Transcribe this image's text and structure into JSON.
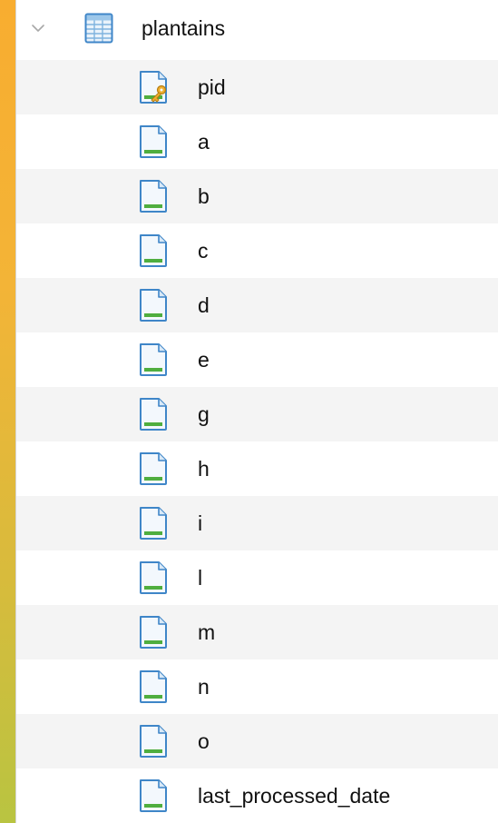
{
  "table": {
    "name": "plantains",
    "expanded": true
  },
  "columns": [
    {
      "label": "pid",
      "icon": "primary-key-column-icon"
    },
    {
      "label": "a",
      "icon": "column-icon"
    },
    {
      "label": "b",
      "icon": "column-icon"
    },
    {
      "label": "c",
      "icon": "column-icon"
    },
    {
      "label": "d",
      "icon": "column-icon"
    },
    {
      "label": "e",
      "icon": "column-icon"
    },
    {
      "label": "g",
      "icon": "column-icon"
    },
    {
      "label": "h",
      "icon": "column-icon"
    },
    {
      "label": "i",
      "icon": "column-icon"
    },
    {
      "label": "l",
      "icon": "column-icon"
    },
    {
      "label": "m",
      "icon": "column-icon"
    },
    {
      "label": "n",
      "icon": "column-icon"
    },
    {
      "label": "o",
      "icon": "column-icon"
    },
    {
      "label": "last_processed_date",
      "icon": "column-icon"
    }
  ],
  "colors": {
    "row_alt": "#f4f4f4",
    "icon_blue": "#3f86c8",
    "icon_green": "#4fae3f",
    "key_gold": "#f0b030"
  }
}
